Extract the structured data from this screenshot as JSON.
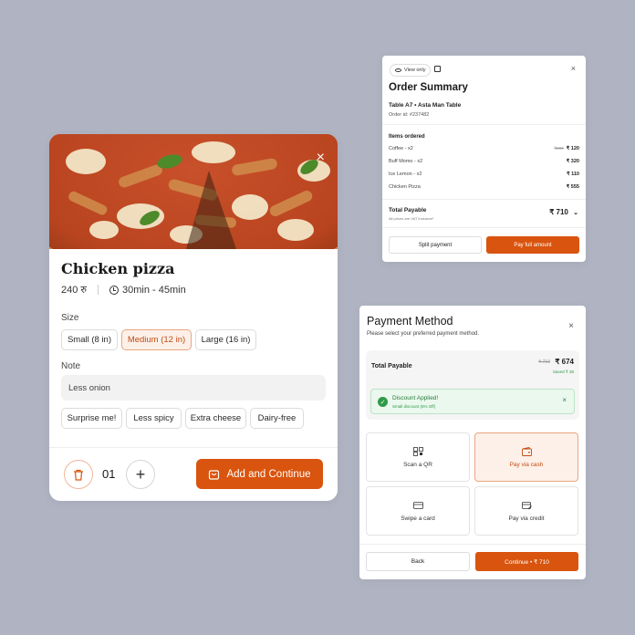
{
  "product": {
    "name": "Chicken pizza",
    "price": "240 रु",
    "time": "30min - 45min",
    "size_label": "Size",
    "sizes": [
      "Small (8 in)",
      "Medium (12 in)",
      "Large (16 in)"
    ],
    "selected_size": "Medium (12 in)",
    "note_label": "Note",
    "note_value": "Less onion",
    "note_chips": [
      "Surprise me!",
      "Less spicy",
      "Extra cheese",
      "Dairy-free"
    ],
    "quantity": "01",
    "add_button": "Add and Continue",
    "close_icon": "close-icon",
    "accent": "#d9540e"
  },
  "order": {
    "view_only": "View only",
    "title": "Order Summary",
    "table": "Table A7 • Asta Man Table",
    "order_id": "Order id: #237482",
    "items_heading": "Items ordered",
    "items": [
      {
        "name": "Coffee - x2",
        "old_price": "₹200",
        "price": "₹ 120"
      },
      {
        "name": "Buff Momo - x2",
        "old_price": "",
        "price": "₹ 320"
      },
      {
        "name": "Ice Lemon - x2",
        "old_price": "",
        "price": "₹ 110"
      },
      {
        "name": "Chicken Pizza",
        "old_price": "",
        "price": "₹ 555"
      }
    ],
    "total_label": "Total Payable",
    "total_note": "All prices are VAT inclusive*",
    "total_value": "₹ 710",
    "split_button": "Split payment",
    "pay_button": "Pay full amount"
  },
  "payment": {
    "title": "Payment Method",
    "subtitle": "Please select your preferred payment method.",
    "total_label": "Total Payable",
    "old_price": "₹ 710",
    "price": "₹ 674",
    "saved": "Saved ₹ 36",
    "discount_title": "Discount Applied!",
    "discount_sub": "Small discount (5% Off)",
    "options": [
      "Scan a QR",
      "Pay via cash",
      "Swipe a card",
      "Pay via credit"
    ],
    "selected_option": "Pay via cash",
    "back_button": "Back",
    "continue_button": "Continue • ₹ 710"
  }
}
